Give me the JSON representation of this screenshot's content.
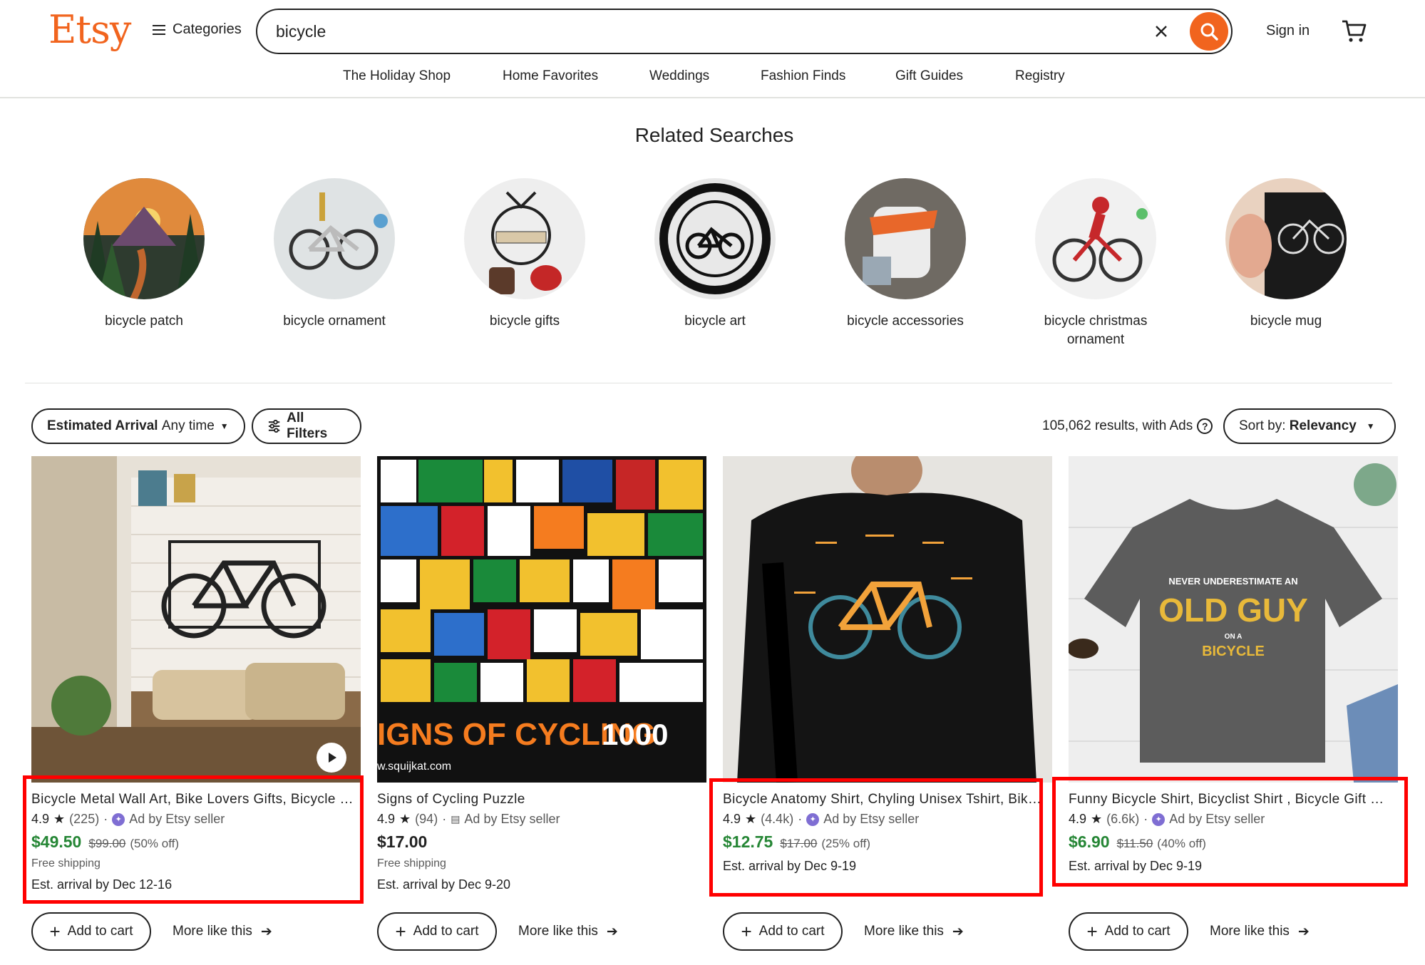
{
  "header": {
    "logo": "Etsy",
    "categories_label": "Categories",
    "search_value": "bicycle",
    "signin_label": "Sign in"
  },
  "nav": [
    "The Holiday Shop",
    "Home Favorites",
    "Weddings",
    "Fashion Finds",
    "Gift Guides",
    "Registry"
  ],
  "related": {
    "title": "Related Searches",
    "items": [
      {
        "label": "bicycle patch"
      },
      {
        "label": "bicycle ornament"
      },
      {
        "label": "bicycle gifts"
      },
      {
        "label": "bicycle art"
      },
      {
        "label": "bicycle accessories"
      },
      {
        "label": "bicycle christmas ornament"
      },
      {
        "label": "bicycle mug"
      }
    ]
  },
  "filters": {
    "arrival_bold": "Estimated Arrival",
    "arrival_value": "Any time",
    "all_filters": "All Filters",
    "results": "105,062 results, with Ads",
    "sort_label": "Sort by:",
    "sort_value": "Relevancy"
  },
  "listings": [
    {
      "title": "Bicycle Metal Wall Art, Bike Lovers Gifts, Bicycle Wall Decor",
      "rating": "4.9",
      "reviews": "(225)",
      "ad": "Ad by Etsy seller",
      "price": "$49.50",
      "original": "$99.00",
      "discount": "(50% off)",
      "shipping": "Free shipping",
      "arrival": "Est. arrival by Dec 12-16",
      "add_to_cart": "Add to cart",
      "more_like": "More like this"
    },
    {
      "title": "Signs of Cycling Puzzle",
      "rating": "4.9",
      "reviews": "(94)",
      "ad": "Ad by Etsy seller",
      "price": "$17.00",
      "shipping": "Free shipping",
      "arrival": "Est. arrival by Dec 9-20",
      "add_to_cart": "Add to cart",
      "more_like": "More like this",
      "image_text_1": "IGNS OF CYCLING",
      "image_text_2": "1000",
      "image_text_3": "w.squijkat.com"
    },
    {
      "title": "Bicycle Anatomy Shirt, Chyling Unisex Tshirt, Bike Lover Gift",
      "rating": "4.9",
      "reviews": "(4.4k)",
      "ad": "Ad by Etsy seller",
      "price": "$12.75",
      "original": "$17.00",
      "discount": "(25% off)",
      "arrival": "Est. arrival by Dec 9-19",
      "add_to_cart": "Add to cart",
      "more_like": "More like this"
    },
    {
      "title": "Funny Bicycle Shirt, Bicyclist Shirt , Bicycle Gift Shirt",
      "rating": "4.9",
      "reviews": "(6.6k)",
      "ad": "Ad by Etsy seller",
      "price": "$6.90",
      "original": "$11.50",
      "discount": "(40% off)",
      "arrival": "Est. arrival by Dec 9-19",
      "add_to_cart": "Add to cart",
      "more_like": "More like this",
      "image_text_1": "NEVER UNDERESTIMATE AN",
      "image_text_2": "OLD GUY",
      "image_text_3": "ON A",
      "image_text_4": "BICYCLE"
    }
  ],
  "colors": {
    "brand": "#f1641e",
    "sale": "#258635",
    "highlight": "#ff0000",
    "ad_badge": "#7f6ed3"
  }
}
